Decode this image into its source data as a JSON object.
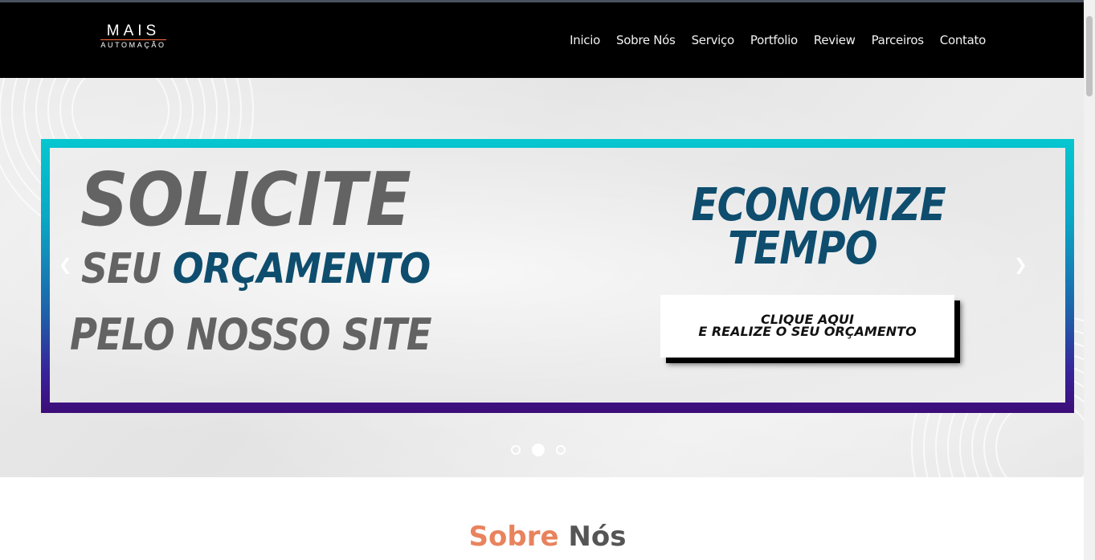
{
  "header": {
    "logo": {
      "main": "MAIS",
      "sub": "AUTOMAÇÃO"
    },
    "nav": [
      "Inicio",
      "Sobre Nós",
      "Serviço",
      "Portfolio",
      "Review",
      "Parceiros",
      "Contato"
    ]
  },
  "hero": {
    "left": {
      "line1": "SOLICITE",
      "line2_part1": "SEU",
      "line2_part2": "ORÇAMENTO",
      "line3": "PELO NOSSO SITE"
    },
    "right": {
      "headline_line1": "ECONOMIZE",
      "headline_line2": "TEMPO",
      "cta_line1": "CLIQUE AQUI",
      "cta_line2": "E REALIZE O SEU ORÇAMENTO"
    },
    "prev_icon": "chevron-left-icon",
    "next_icon": "chevron-right-icon",
    "slides_total": 3,
    "active_slide": 2
  },
  "about": {
    "title_word1": "Sobre",
    "title_word2": "Nós"
  },
  "colors": {
    "nav_bg": "#000000",
    "blue_text": "#0e4d6e",
    "gray_text": "#636363",
    "accent_orange": "#e8835d",
    "frame_top": "#06c7d0",
    "frame_bottom": "#3d0d78"
  }
}
